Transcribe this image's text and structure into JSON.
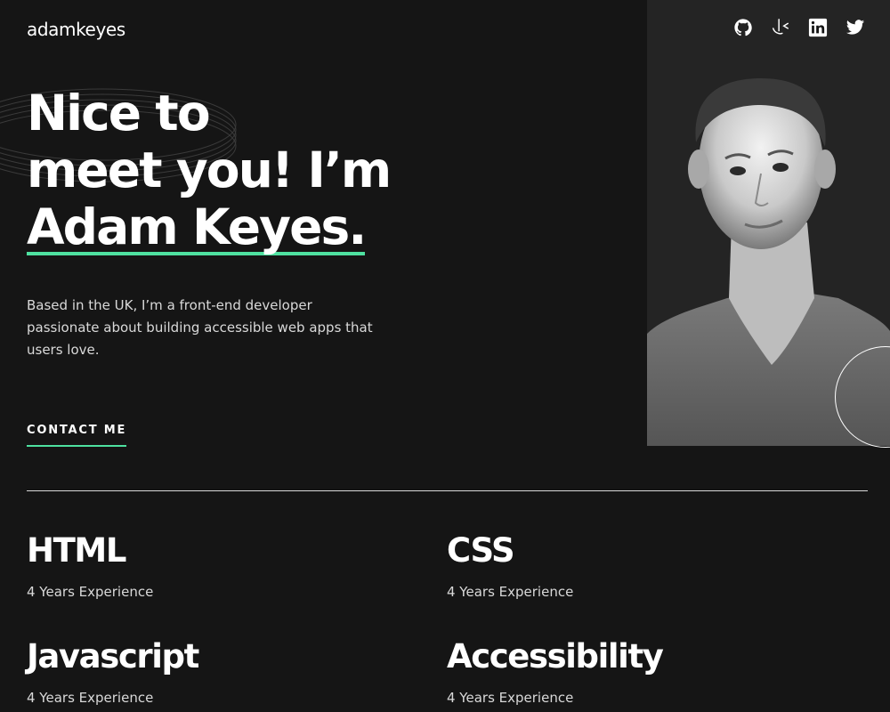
{
  "header": {
    "logo": "adamkeyes",
    "social": [
      {
        "name": "github-icon"
      },
      {
        "name": "frontend-mentor-icon"
      },
      {
        "name": "linkedin-icon"
      },
      {
        "name": "twitter-icon"
      }
    ]
  },
  "hero": {
    "title_line1": "Nice to",
    "title_line2": "meet you! I’m",
    "title_line3": "Adam Keyes.",
    "description": "Based in the UK, I’m a front-end developer passionate about building accessible web apps that users love.",
    "contact_label": "CONTACT ME"
  },
  "skills": [
    {
      "name": "HTML",
      "experience": "4 Years Experience"
    },
    {
      "name": "CSS",
      "experience": "4 Years Experience"
    },
    {
      "name": "Javascript",
      "experience": "4 Years Experience"
    },
    {
      "name": "Accessibility",
      "experience": "4 Years Experience"
    }
  ],
  "colors": {
    "background": "#151515",
    "accent": "#4ee1a0",
    "text": "#ffffff",
    "muted": "#d9d9d9",
    "portrait_bg": "#242424"
  }
}
